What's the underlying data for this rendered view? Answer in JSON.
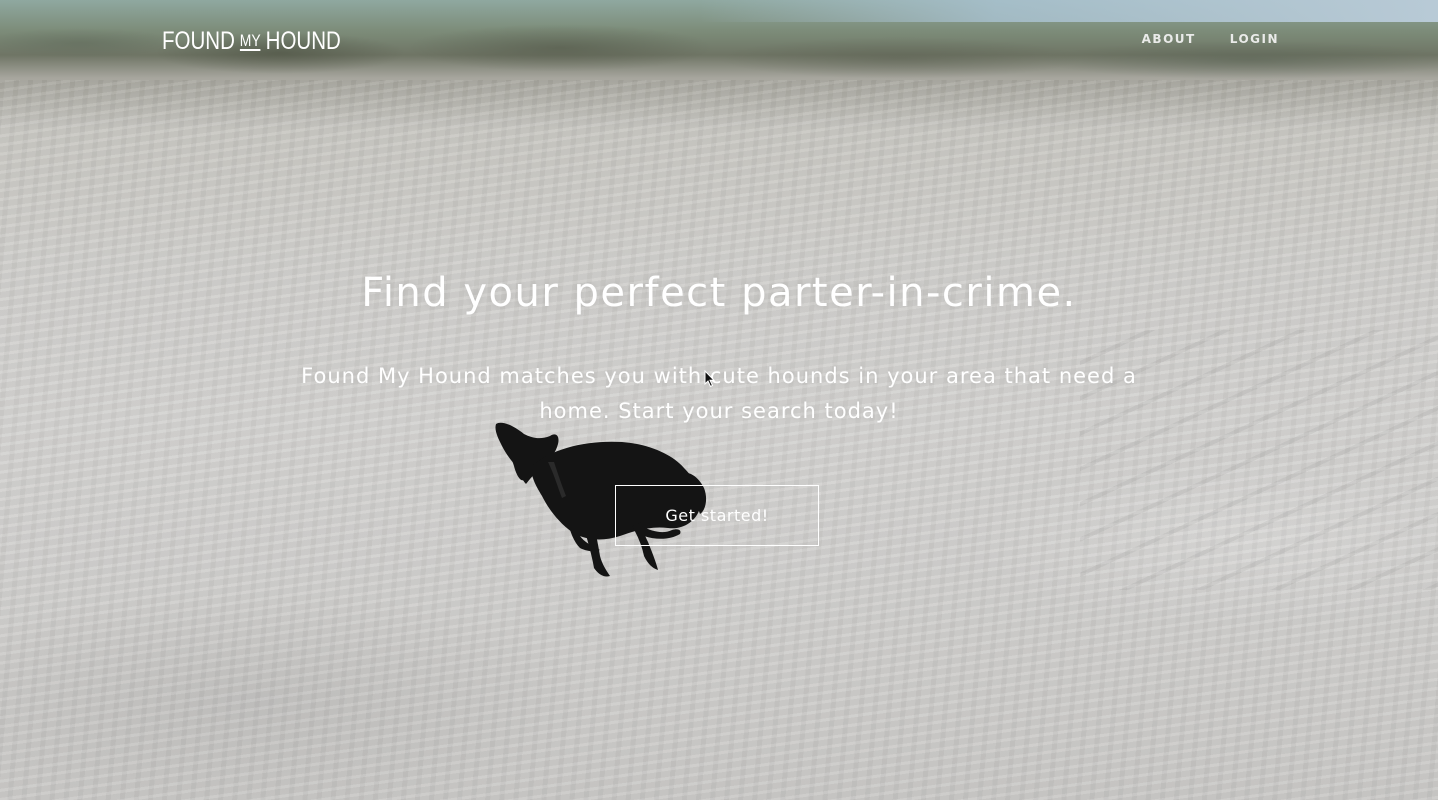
{
  "brand": {
    "logo_left": "FOUND",
    "logo_middle": "MY",
    "logo_right": "HOUND"
  },
  "nav": {
    "items": [
      {
        "label": "ABOUT"
      },
      {
        "label": "LOGIN"
      }
    ]
  },
  "hero": {
    "headline": "Find your perfect parter-in-crime.",
    "subtext": "Found My Hound matches you with cute hounds in your area that need a home. Start your search today!",
    "cta_label": "Get started!"
  },
  "colors": {
    "text": "#ffffff",
    "sand": "#d0cfcc",
    "dog": "#121212"
  }
}
